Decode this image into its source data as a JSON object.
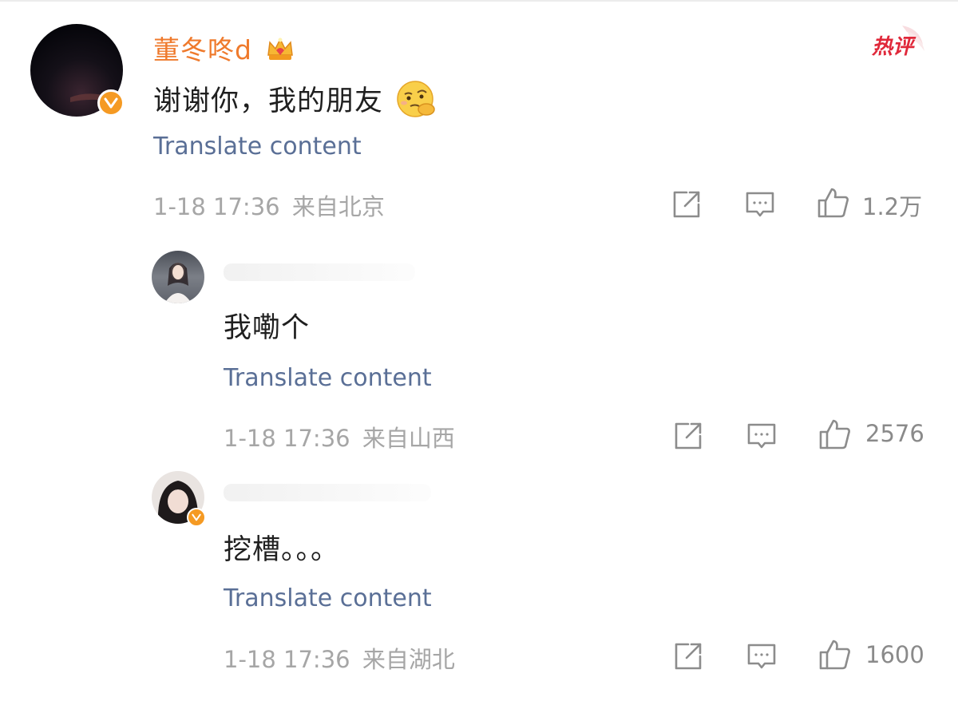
{
  "hot_badge": "热评",
  "main_comment": {
    "username": "董冬咚d",
    "text": "谢谢你，我的朋友",
    "translate": "Translate content",
    "time": "1-18 17:36",
    "location": "来自北京",
    "likes": "1.2万"
  },
  "replies": [
    {
      "text": "我嘞个",
      "translate": "Translate content",
      "time": "1-18 17:36",
      "location": "来自山西",
      "likes": "2576"
    },
    {
      "text": "挖槽。。。",
      "translate": "Translate content",
      "time": "1-18 17:36",
      "location": "来自湖北",
      "likes": "1600"
    }
  ],
  "colors": {
    "username": "#ef7a2c",
    "translate": "#5a6f96",
    "meta": "#a6a6a6",
    "verified": "#f59a23",
    "hot": "#e0283a"
  },
  "icons": [
    "crown-icon",
    "emoji-pensive-icon",
    "share-icon",
    "comment-icon",
    "like-icon",
    "verified-icon"
  ]
}
